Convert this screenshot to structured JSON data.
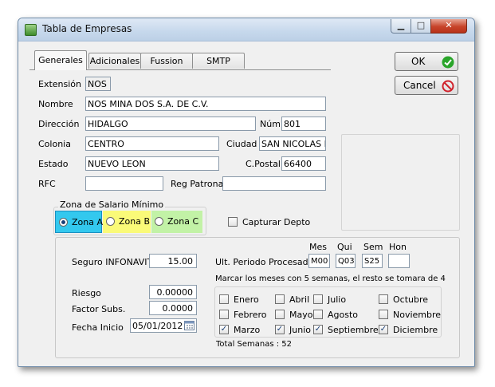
{
  "window": {
    "title": "Tabla de Empresas",
    "minimize": "▁",
    "maximize": "□",
    "close": "✕"
  },
  "tabs": [
    "Generales",
    "Adicionales",
    "Fussion",
    "SMTP"
  ],
  "buttons": {
    "ok": "OK",
    "cancel": "Cancel"
  },
  "generales": {
    "extension_label": "Extensión",
    "extension_value": "NOS",
    "nombre_label": "Nombre",
    "nombre_value": "NOS MINA DOS S.A. DE C.V.",
    "direccion_label": "Dirección",
    "direccion_value": "HIDALGO",
    "num_label": "Núm",
    "num_value": "801",
    "colonia_label": "Colonia",
    "colonia_value": "CENTRO",
    "ciudad_label": "Ciudad",
    "ciudad_value": "SAN NICOLAS DE",
    "estado_label": "Estado",
    "estado_value": "NUEVO LEON",
    "cpostal_label": "C.Postal",
    "cpostal_value": "66400",
    "rfc_label": "RFC",
    "rfc_value": "",
    "regpatronal_label": "Reg Patronal",
    "regpatronal_value": ""
  },
  "zona": {
    "title": "Zona de Salario Mínimo",
    "options": [
      {
        "label": "Zona A",
        "color": "#33c8ee",
        "selected": true
      },
      {
        "label": "Zona B",
        "color": "#fafa78",
        "selected": false
      },
      {
        "label": "Zona C",
        "color": "#c2f2a6",
        "selected": false
      }
    ]
  },
  "capturar_depto": {
    "label": "Capturar Depto",
    "checked": false
  },
  "lower": {
    "seguro_label": "Seguro INFONAVIT",
    "seguro_value": "15.00",
    "riesgo_label": "Riesgo",
    "riesgo_value": "0.00000",
    "factor_label": "Factor Subs.",
    "factor_value": "0.0000",
    "fecha_label": "Fecha Inicio",
    "fecha_value": "05/01/2012",
    "ult_label": "Ult. Periodo Procesado",
    "periodo_headers": [
      "Mes",
      "Qui",
      "Sem",
      "Hon"
    ],
    "periodo_values": [
      "M00",
      "Q03",
      "S25",
      ""
    ],
    "marcar_text": "Marcar los meses con 5 semanas, el resto se tomara de 4",
    "total_label": "Total Semanas : 52"
  },
  "meses": [
    {
      "label": "Enero",
      "checked": false
    },
    {
      "label": "Abril",
      "checked": false
    },
    {
      "label": "Julio",
      "checked": false
    },
    {
      "label": "Octubre",
      "checked": false
    },
    {
      "label": "Febrero",
      "checked": false
    },
    {
      "label": "Mayo",
      "checked": false
    },
    {
      "label": "Agosto",
      "checked": false
    },
    {
      "label": "Noviembre",
      "checked": false
    },
    {
      "label": "Marzo",
      "checked": true
    },
    {
      "label": "Junio",
      "checked": true
    },
    {
      "label": "Septiembre",
      "checked": true
    },
    {
      "label": "Diciembre",
      "checked": true
    }
  ],
  "icons": {
    "ok": "check-circle-icon",
    "cancel": "no-entry-icon",
    "calendar": "calendar-icon"
  },
  "colors": {
    "ok_green": "#2aa52a",
    "cancel_red": "#d0202a"
  }
}
